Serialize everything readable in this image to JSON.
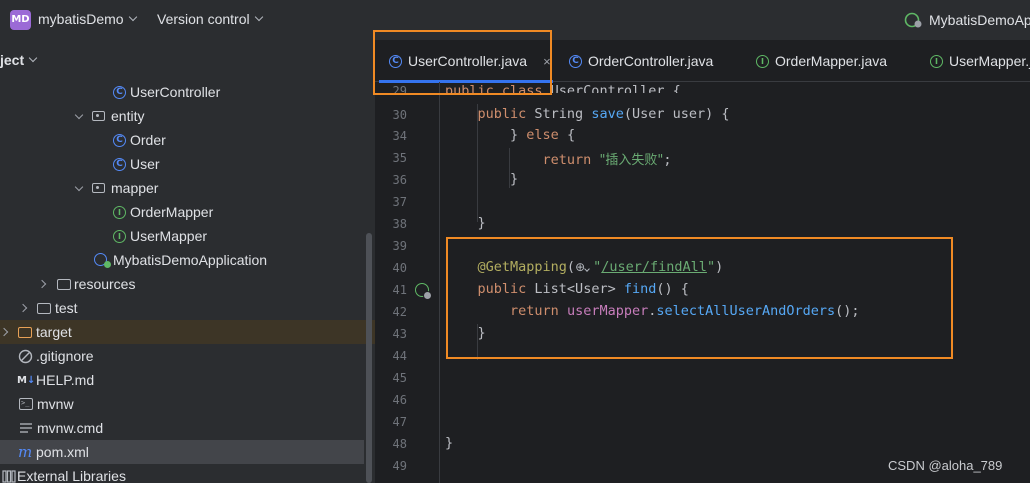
{
  "titlebar": {
    "project_badge": "MD",
    "project_name": "mybatisDemo",
    "vcs_label": "Version control",
    "run_config": "MybatisDemoAp"
  },
  "project_panel": {
    "header": "ject",
    "items": [
      {
        "label": "UserController",
        "icon": "class-icon"
      },
      {
        "label": "entity",
        "icon": "package-icon"
      },
      {
        "label": "Order",
        "icon": "class-icon"
      },
      {
        "label": "User",
        "icon": "class-icon"
      },
      {
        "label": "mapper",
        "icon": "package-icon"
      },
      {
        "label": "OrderMapper",
        "icon": "interface-icon"
      },
      {
        "label": "UserMapper",
        "icon": "interface-icon"
      },
      {
        "label": "MybatisDemoApplication",
        "icon": "spring-class-icon"
      },
      {
        "label": "resources",
        "icon": "resources-folder-icon"
      },
      {
        "label": "test",
        "icon": "folder-icon"
      },
      {
        "label": "target",
        "icon": "folder-icon"
      },
      {
        "label": ".gitignore",
        "icon": "ignore-icon"
      },
      {
        "label": "HELP.md",
        "icon": "markdown-icon"
      },
      {
        "label": "mvnw",
        "icon": "terminal-icon"
      },
      {
        "label": "mvnw.cmd",
        "icon": "text-icon"
      },
      {
        "label": "pom.xml",
        "icon": "maven-icon"
      },
      {
        "label": "External Libraries",
        "icon": "library-icon"
      }
    ]
  },
  "tabs": [
    {
      "label": "UserController.java",
      "icon": "class-icon",
      "active": true,
      "close": "×"
    },
    {
      "label": "OrderController.java",
      "icon": "class-icon"
    },
    {
      "label": "OrderMapper.java",
      "icon": "interface-icon"
    },
    {
      "label": "UserMapper.j",
      "icon": "interface-icon"
    }
  ],
  "code": {
    "line_numbers": [
      "29",
      "30",
      "34",
      "35",
      "36",
      "37",
      "38",
      "39",
      "40",
      "41",
      "42",
      "43",
      "44",
      "45",
      "46",
      "47",
      "48",
      "49"
    ],
    "l29_kw": "public class ",
    "l29_name": "UserController {",
    "l30_kw1": "public ",
    "l30_type": "String ",
    "l30_fn": "save",
    "l30_rest": "(User user) {",
    "l34_a": "} ",
    "l34_kw": "else",
    "l34_b": " {",
    "l35_kw": "return ",
    "l35_str": "\"插入失败\"",
    "l35_end": ";",
    "l36": "}",
    "l38": "}",
    "l40_ann": "@GetMapping",
    "l40_open": "(",
    "l40_globe": "⊕",
    "l40_q1": "\"",
    "l40_url": "/user/findAll",
    "l40_q2": "\"",
    "l40_close": ")",
    "l41_kw": "public ",
    "l41_type": "List<User> ",
    "l41_fn": "find",
    "l41_rest": "() {",
    "l42_kw": "return ",
    "l42_fld": "userMapper",
    "l42_dot": ".",
    "l42_fn": "selectAllUserAndOrders",
    "l42_end": "();",
    "l43": "}",
    "l48": "}"
  },
  "watermark": "CSDN @aloha_789",
  "colors": {
    "highlight": "#f08a24",
    "accent": "#3574f0"
  }
}
